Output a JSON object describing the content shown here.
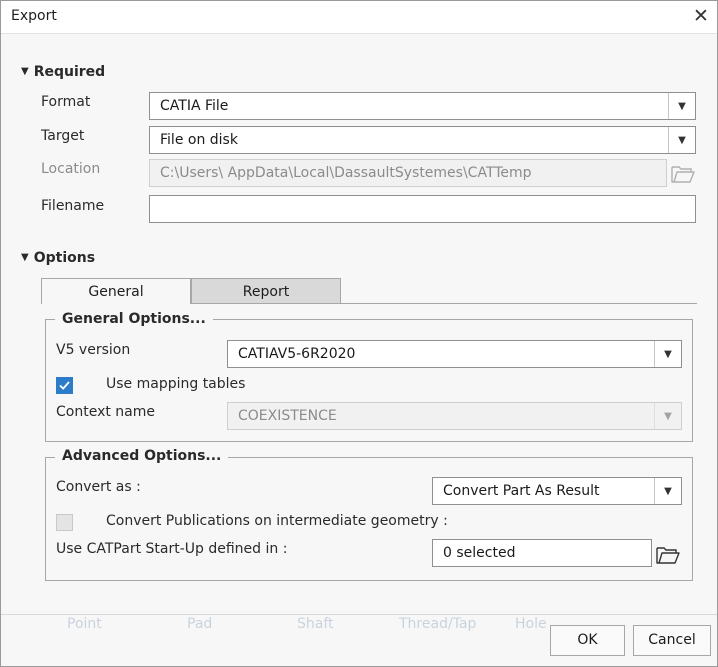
{
  "window": {
    "title": "Export",
    "close_glyph": "✕"
  },
  "required": {
    "header": "Required",
    "format": {
      "label": "Format",
      "value": "CATIA File"
    },
    "target": {
      "label": "Target",
      "value": "File on disk"
    },
    "location": {
      "label": "Location",
      "value": "C:\\Users\\        AppData\\Local\\DassaultSystemes\\CATTemp"
    },
    "filename": {
      "label": "Filename",
      "value": ""
    }
  },
  "options": {
    "header": "Options",
    "tabs": [
      {
        "label": "General",
        "active": true
      },
      {
        "label": "Report",
        "active": false
      }
    ],
    "general_group": {
      "title": "General Options...",
      "v5_version": {
        "label": "V5 version",
        "value": "CATIAV5-6R2020"
      },
      "use_mapping_tables": {
        "label": "Use mapping tables",
        "checked": true
      },
      "context_name": {
        "label": "Context name",
        "value": "COEXISTENCE"
      }
    },
    "advanced_group": {
      "title": "Advanced Options...",
      "convert_as": {
        "label": "Convert as :",
        "value": "Convert Part As Result"
      },
      "convert_publications": {
        "label": "Convert Publications on intermediate geometry :",
        "checked": false
      },
      "startup": {
        "label": "Use CATPart Start-Up defined in :",
        "value": "0 selected"
      }
    }
  },
  "background_labels": [
    "Point",
    "Pad",
    "Shaft",
    "Thread/Tap",
    "Hole"
  ],
  "buttons": {
    "ok": "OK",
    "cancel": "Cancel"
  },
  "colors": {
    "accent": "#2c7cc9",
    "dialog_bg": "#f7f7f7",
    "tab_inactive": "#d9d9d9"
  }
}
